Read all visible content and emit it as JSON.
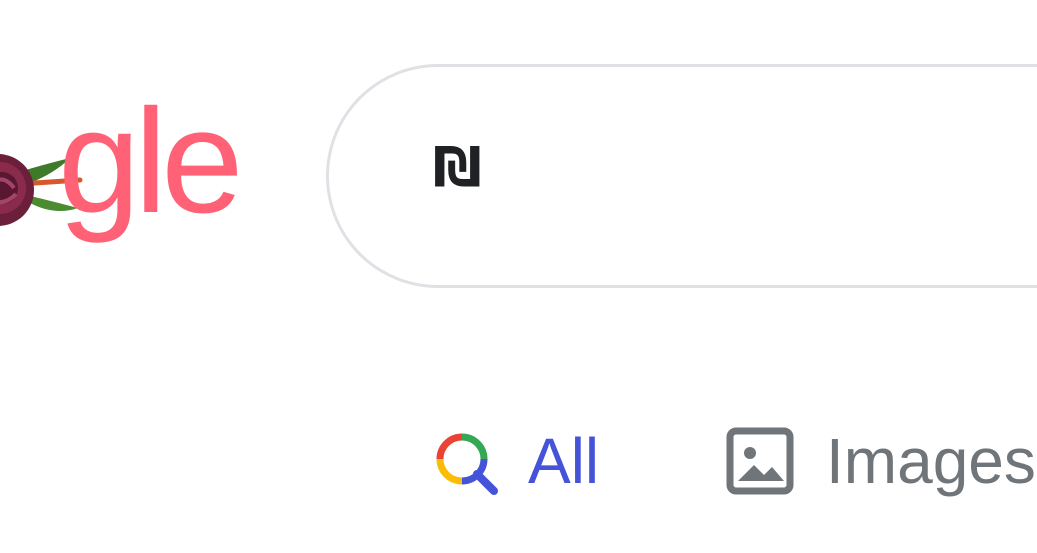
{
  "logo": {
    "visible_text": "gle",
    "color": "#ff6277",
    "doodle_icon": "rose-doodle-icon"
  },
  "search": {
    "value": "₪",
    "border_color": "#dfe1e5"
  },
  "tabs": [
    {
      "label": "All",
      "icon": "multicolor-search-icon",
      "active": true,
      "color": "#4553d9"
    },
    {
      "label": "Images",
      "icon": "image-icon",
      "active": false,
      "color": "#70757a"
    }
  ]
}
